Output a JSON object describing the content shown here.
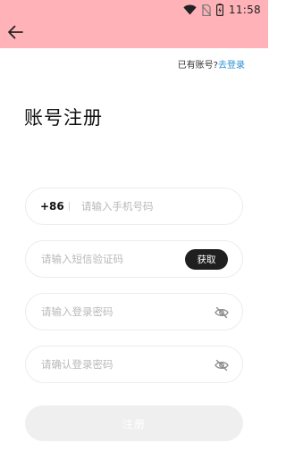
{
  "status_bar": {
    "time": "11:58",
    "icons": [
      "wifi-icon",
      "no-sim-icon",
      "battery-icon"
    ]
  },
  "header": {
    "back_icon": "arrow-left-icon",
    "bar_color": "#FFB3B8"
  },
  "login_prompt": {
    "text": "已有账号?",
    "link_label": "去登录",
    "link_color": "#2a8fd6"
  },
  "title": "账号注册",
  "form": {
    "phone": {
      "country_code": "+86",
      "placeholder": "请输入手机号码",
      "value": ""
    },
    "sms_code": {
      "placeholder": "请输入短信验证码",
      "value": "",
      "get_code_label": "获取"
    },
    "password": {
      "placeholder": "请输入登录密码",
      "value": "",
      "visibility_icon": "eye-off-icon"
    },
    "confirm_password": {
      "placeholder": "请确认登录密码",
      "value": "",
      "visibility_icon": "eye-off-icon"
    },
    "submit_label": "注册"
  }
}
